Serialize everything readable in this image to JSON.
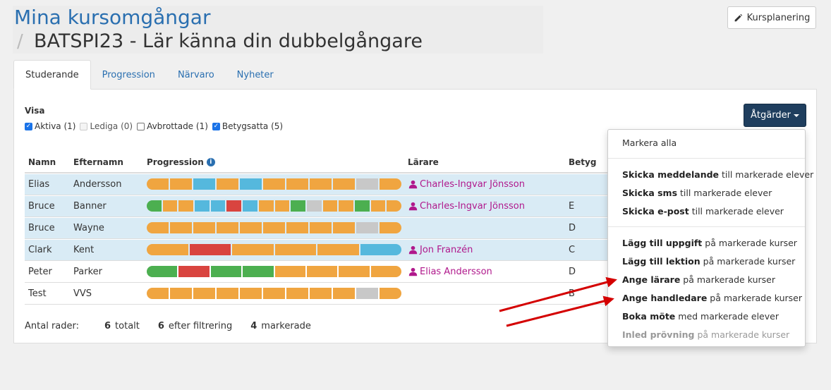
{
  "breadcrumb": {
    "root": "Mina kursomgångar",
    "separator": "/",
    "title": "BATSPI23 - Lär känna din dubbelgångare"
  },
  "kursplanering_button": "Kursplanering",
  "tabs": [
    {
      "label": "Studerande",
      "active": true
    },
    {
      "label": "Progression",
      "active": false
    },
    {
      "label": "Närvaro",
      "active": false
    },
    {
      "label": "Nyheter",
      "active": false
    }
  ],
  "filters": {
    "label": "Visa",
    "items": [
      {
        "label": "Aktiva (1)",
        "checked": true
      },
      {
        "label": "Lediga (0)",
        "checked": false,
        "disabled": true
      },
      {
        "label": "Avbrottade (1)",
        "checked": false
      },
      {
        "label": "Betygsatta (5)",
        "checked": true
      }
    ]
  },
  "actions_button": "Åtgärder",
  "table": {
    "headers": {
      "namn": "Namn",
      "efternamn": "Efternamn",
      "progression": "Progression",
      "larare": "Lärare",
      "betyg": "Betyg"
    },
    "rows": [
      {
        "namn": "Elias",
        "efternamn": "Andersson",
        "larare": "Charles-Ingvar Jönsson",
        "betyg": "",
        "selected": true,
        "progress": [
          "orange",
          "orange",
          "blue",
          "orange",
          "blue",
          "orange",
          "orange",
          "orange",
          "orange",
          "gray",
          "orange"
        ]
      },
      {
        "namn": "Bruce",
        "efternamn": "Banner",
        "larare": "Charles-Ingvar Jönsson",
        "betyg": "E",
        "selected": true,
        "progress": [
          "green",
          "orange",
          "orange",
          "blue",
          "blue",
          "red",
          "blue",
          "orange",
          "orange",
          "green",
          "gray",
          "orange",
          "orange",
          "green",
          "orange",
          "orange"
        ]
      },
      {
        "namn": "Bruce",
        "efternamn": "Wayne",
        "larare": "",
        "betyg": "D",
        "selected": true,
        "progress": [
          "orange",
          "orange",
          "orange",
          "orange",
          "orange",
          "orange",
          "orange",
          "orange",
          "orange",
          "gray",
          "orange"
        ]
      },
      {
        "namn": "Clark",
        "efternamn": "Kent",
        "larare": "Jon Franzén",
        "betyg": "C",
        "selected": true,
        "progress": [
          "orange",
          "red",
          "orange",
          "orange",
          "orange",
          "blue"
        ]
      },
      {
        "namn": "Peter",
        "efternamn": "Parker",
        "larare": "Elias Andersson",
        "betyg": "D",
        "selected": false,
        "progress": [
          "green",
          "red",
          "green",
          "green",
          "orange",
          "orange",
          "orange",
          "orange"
        ]
      },
      {
        "namn": "Test",
        "efternamn": "VVS",
        "larare": "",
        "betyg": "B",
        "selected": false,
        "progress": [
          "orange",
          "orange",
          "orange",
          "orange",
          "orange",
          "orange",
          "orange",
          "orange",
          "orange",
          "gray",
          "orange"
        ]
      }
    ]
  },
  "footer": {
    "label": "Antal rader:",
    "total": "6",
    "total_label": "totalt",
    "filtered": "6",
    "filtered_label": "efter filtrering",
    "marked": "4",
    "marked_label": "markerade"
  },
  "dropdown": {
    "select_all": "Markera alla",
    "items": [
      {
        "bold": "Skicka meddelande",
        "rest": " till markerade elever",
        "disabled": false
      },
      {
        "bold": "Skicka sms",
        "rest": " till markerade elever",
        "disabled": false
      },
      {
        "bold": "Skicka e-post",
        "rest": " till markerade elever",
        "disabled": false
      },
      {
        "bold": "Lägg till uppgift",
        "rest": " på markerade kurser",
        "disabled": false
      },
      {
        "bold": "Lägg till lektion",
        "rest": " på markerade kurser",
        "disabled": false
      },
      {
        "bold": "Ange lärare",
        "rest": " på markerade kurser",
        "disabled": false
      },
      {
        "bold": "Ange handledare",
        "rest": " på markerade kurser",
        "disabled": false
      },
      {
        "bold": "Boka möte",
        "rest": " med markerade elever",
        "disabled": false
      },
      {
        "bold": "Inled prövning",
        "rest": " på markerade kurser",
        "disabled": true
      }
    ]
  },
  "colors": {
    "orange": "#f0a540",
    "blue": "#55b8dd",
    "green": "#4caf50",
    "red": "#d9443f",
    "gray": "#c8c8c8",
    "link": "#2a6fb0",
    "teacher": "#b0198c",
    "accent_button": "#1f3e5e",
    "annotation_arrow": "#d40000"
  },
  "icons": {
    "edit": "pencil-icon",
    "info": "info-icon",
    "teacher": "person-icon",
    "caret": "caret-down-icon"
  }
}
